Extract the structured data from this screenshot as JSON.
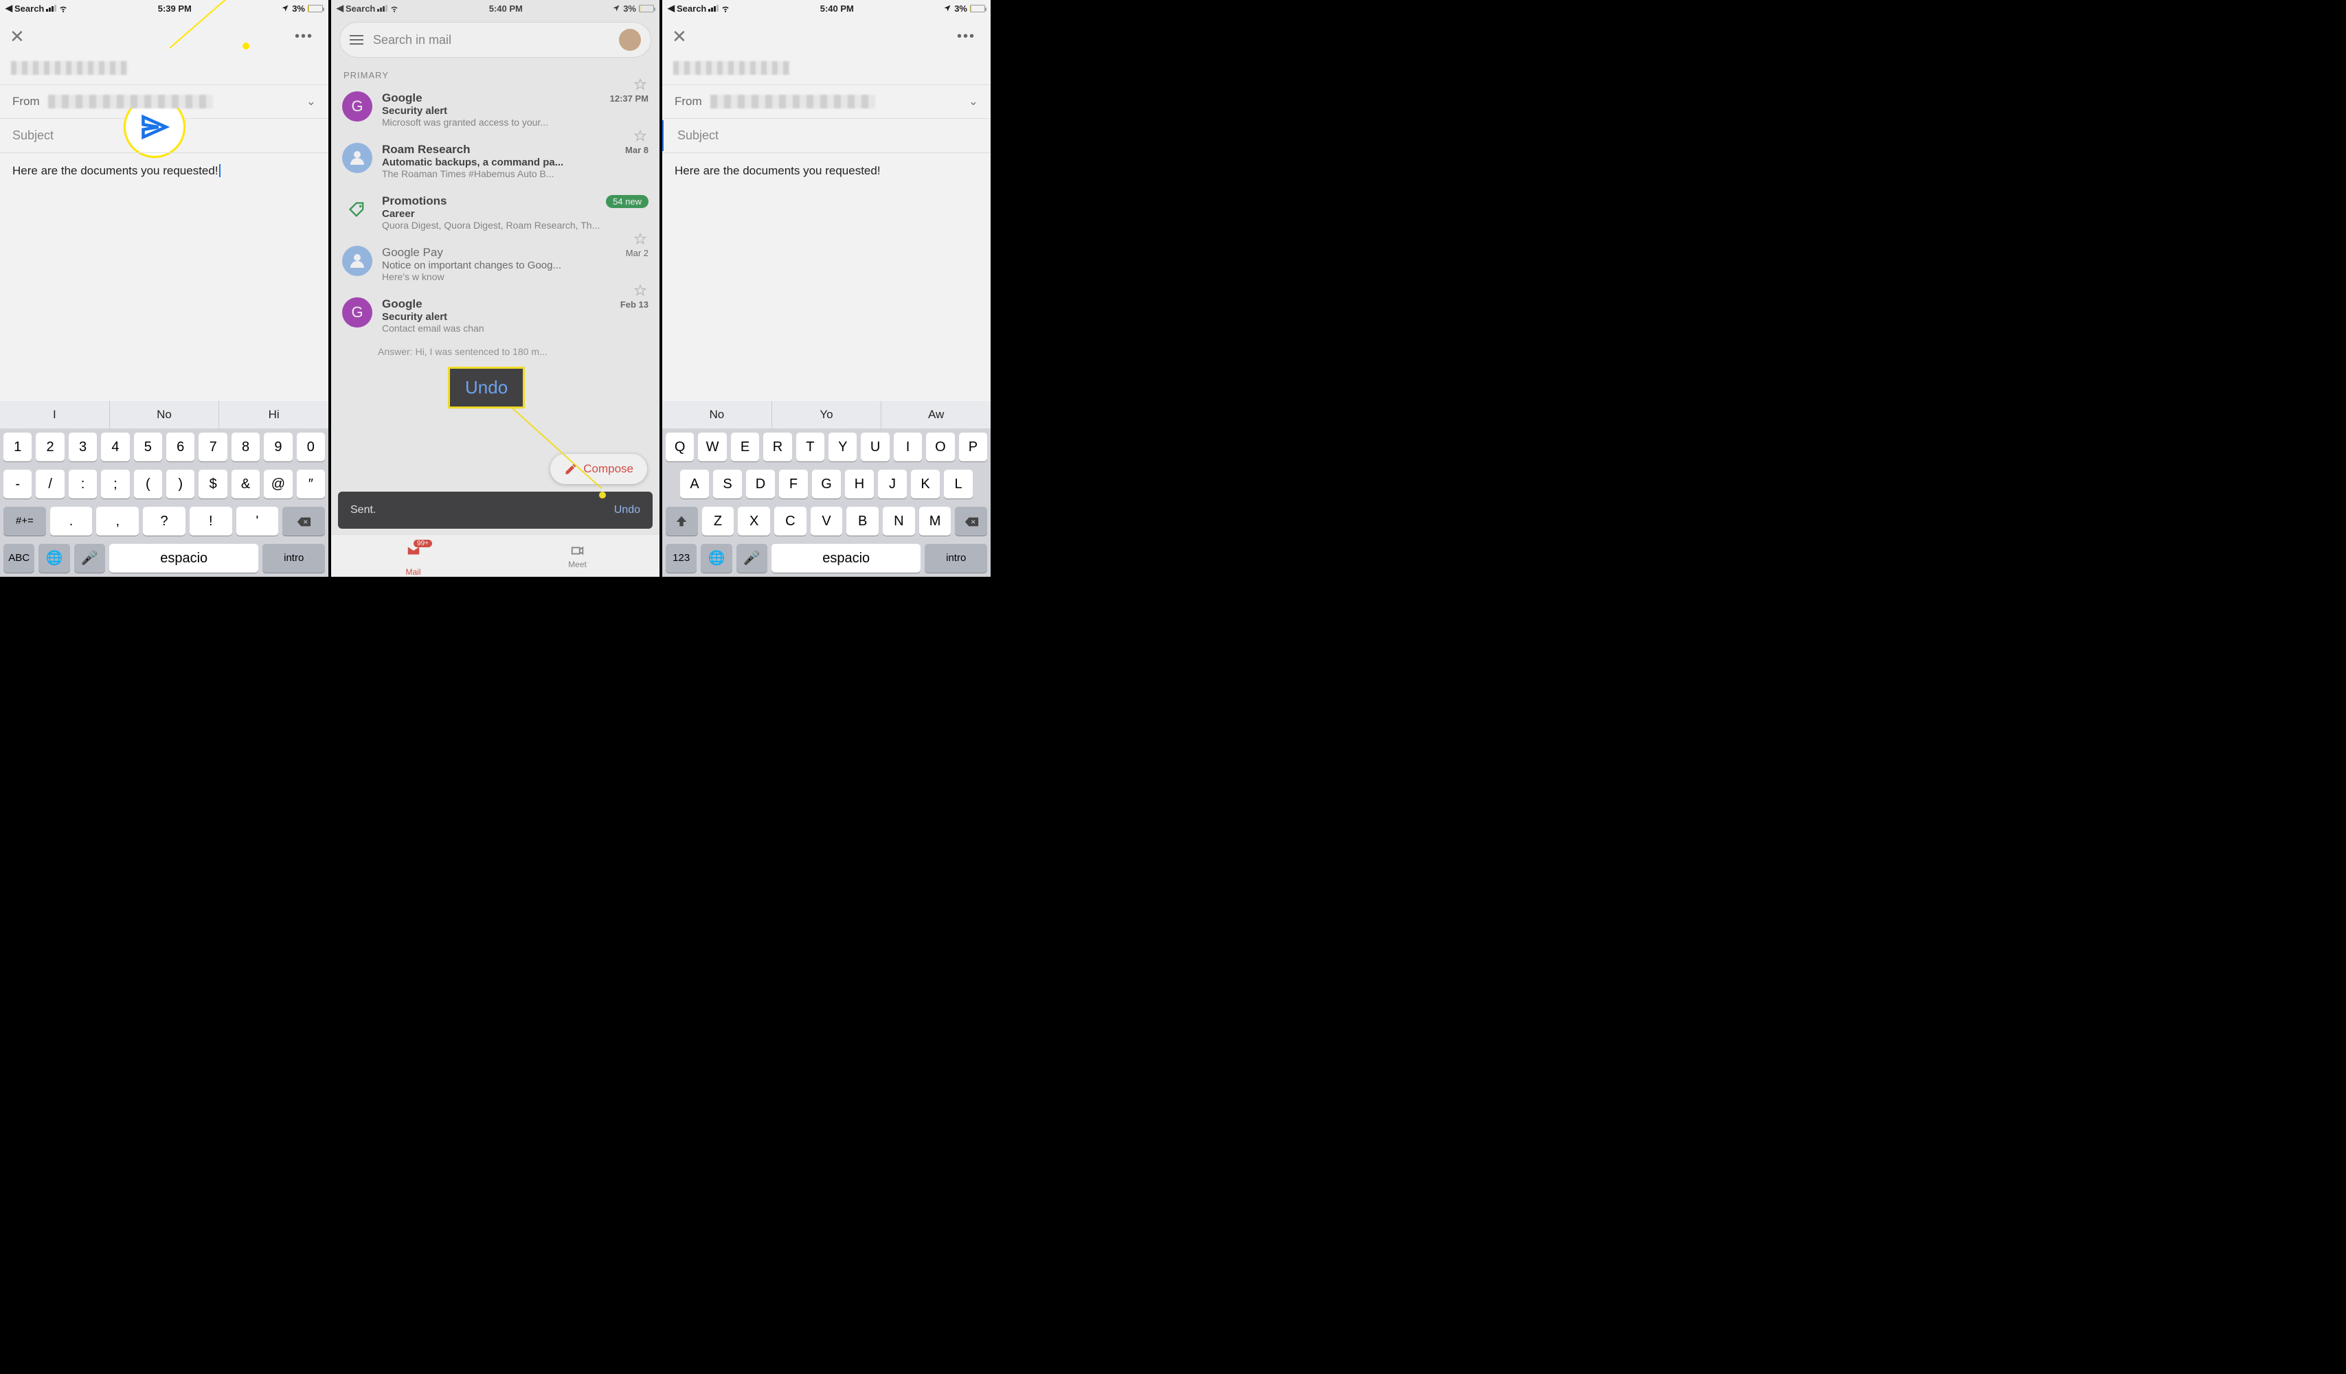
{
  "status": {
    "back_label": "Search",
    "time_p1": "5:39 PM",
    "time_p2": "5:40 PM",
    "time_p3": "5:40 PM",
    "battery_pct": "3%"
  },
  "compose": {
    "from_label": "From",
    "subject_placeholder": "Subject",
    "body_text": "Here are the documents you requested!"
  },
  "predict1": [
    "I",
    "No",
    "Hi"
  ],
  "predict3": [
    "No",
    "Yo",
    "Aw"
  ],
  "kbd_sym_row1": [
    "1",
    "2",
    "3",
    "4",
    "5",
    "6",
    "7",
    "8",
    "9",
    "0"
  ],
  "kbd_sym_row2": [
    "-",
    "/",
    ":",
    ";",
    "(",
    ")",
    "$",
    "&",
    "@",
    "″"
  ],
  "kbd_sym_row3_left": "#+=",
  "kbd_sym_row3": [
    ".",
    ",",
    "?",
    "!",
    "'"
  ],
  "kbd_qwerty_row1": [
    "Q",
    "W",
    "E",
    "R",
    "T",
    "Y",
    "U",
    "I",
    "O",
    "P"
  ],
  "kbd_qwerty_row2": [
    "A",
    "S",
    "D",
    "F",
    "G",
    "H",
    "J",
    "K",
    "L"
  ],
  "kbd_qwerty_row3": [
    "Z",
    "X",
    "C",
    "V",
    "B",
    "N",
    "M"
  ],
  "kbd_bottom": {
    "abc": "ABC",
    "num": "123",
    "space": "espacio",
    "enter": "intro"
  },
  "inbox": {
    "search_placeholder": "Search in mail",
    "section": "PRIMARY",
    "items": [
      {
        "avatar": "G",
        "avclass": "purple",
        "sender": "Google",
        "time": "12:37 PM",
        "subject": "Security alert",
        "snippet": "Microsoft was granted access to your...",
        "bold": true
      },
      {
        "avatar": "person",
        "avclass": "person",
        "sender": "Roam Research",
        "time": "Mar 8",
        "subject": "Automatic backups, a command pa...",
        "snippet": "The Roaman Times #Habemus Auto B...",
        "bold": true
      },
      {
        "avatar": "promo",
        "sender": "Promotions",
        "badge": "54 new",
        "subject": "Career",
        "snippet": "Quora Digest, Quora Digest, Roam Research, Th...",
        "bold": true
      },
      {
        "avatar": "person",
        "avclass": "person",
        "sender": "Google Pay",
        "time": "Mar 2",
        "subject": "Notice on important changes to Goog...",
        "snippet": "Here's w                              know",
        "bold": false
      },
      {
        "avatar": "G",
        "avclass": "purple",
        "sender": "Google",
        "time": "Feb 13",
        "subject": "Security alert",
        "snippet": "Contact email was chan",
        "bold": true
      },
      {
        "snippet_only": "Answer: Hi, I was sentenced to 180 m..."
      }
    ],
    "compose_label": "Compose",
    "toast_text": "Sent.",
    "toast_action": "Undo",
    "undo_bubble": "Undo",
    "nav_mail": "Mail",
    "nav_meet": "Meet",
    "nav_badge": "99+"
  }
}
